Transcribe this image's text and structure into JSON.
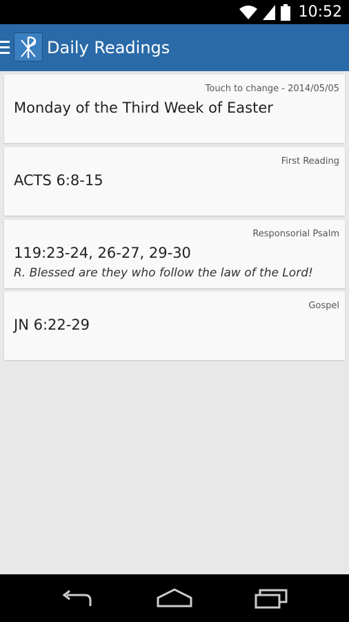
{
  "status_bar": {
    "time": "10:52",
    "icons": [
      "wifi-icon",
      "signal-icon",
      "battery-icon"
    ]
  },
  "action_bar": {
    "title": "Daily Readings",
    "icons": [
      "drawer-icon",
      "chi-rho-icon"
    ],
    "color": "#2a6aa8"
  },
  "cards": [
    {
      "label": "Touch to change - 2014/05/05",
      "main": "Monday of the Third Week of Easter"
    },
    {
      "label": "First Reading",
      "main": "ACTS 6:8-15"
    },
    {
      "label": "Responsorial Psalm",
      "main": "119:23-24, 26-27, 29-30",
      "sub": "R. Blessed are they who follow the law of the Lord!"
    },
    {
      "label": "Gospel",
      "main": "JN 6:22-29"
    }
  ],
  "nav_bar": {
    "buttons": [
      "back-icon",
      "home-icon",
      "recent-apps-icon"
    ]
  }
}
